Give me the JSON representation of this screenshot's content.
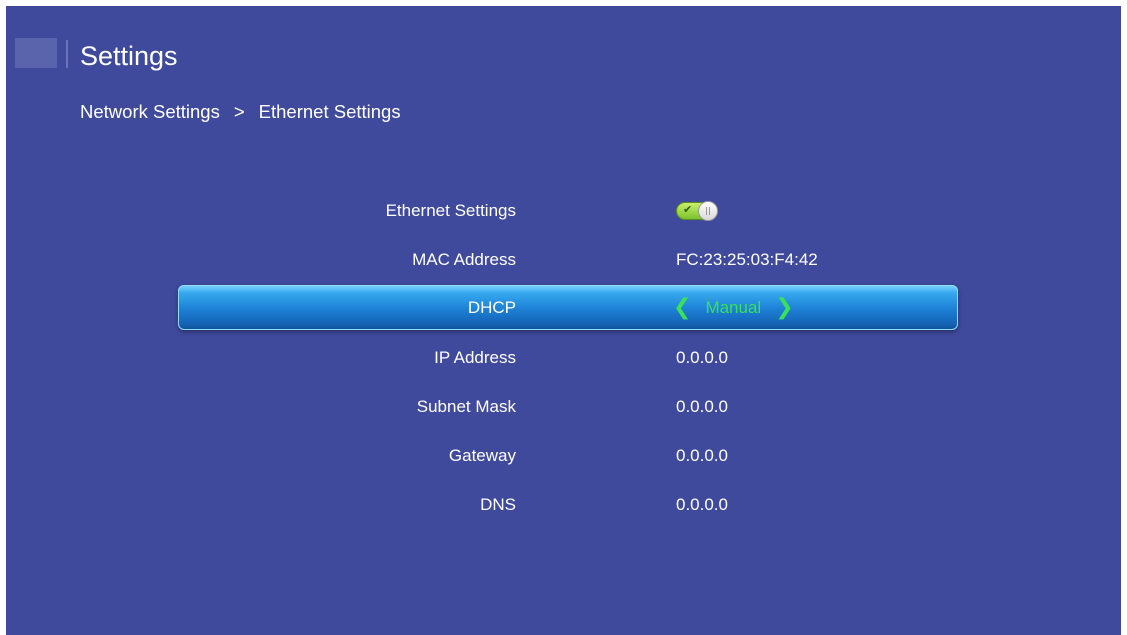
{
  "header": {
    "title": "Settings"
  },
  "breadcrumb": {
    "parent": "Network Settings",
    "separator": ">",
    "current": "Ethernet Settings"
  },
  "rows": {
    "ethernet": {
      "label": "Ethernet Settings",
      "toggle_state": "on"
    },
    "mac": {
      "label": "MAC Address",
      "value": "FC:23:25:03:F4:42"
    },
    "dhcp": {
      "label": "DHCP",
      "value": "Manual",
      "left_arrow": "❮",
      "right_arrow": "❯"
    },
    "ip": {
      "label": "IP Address",
      "value": "0.0.0.0"
    },
    "subnet": {
      "label": "Subnet Mask",
      "value": "0.0.0.0"
    },
    "gateway": {
      "label": "Gateway",
      "value": "0.0.0.0"
    },
    "dns": {
      "label": "DNS",
      "value": "0.0.0.0"
    }
  },
  "colors": {
    "background": "#3f4a9c",
    "selection": "#1c7fd4",
    "selected_value": "#3be05a",
    "toggle_on": "#9bd740"
  },
  "icons": {
    "toggle_check": "✔"
  }
}
